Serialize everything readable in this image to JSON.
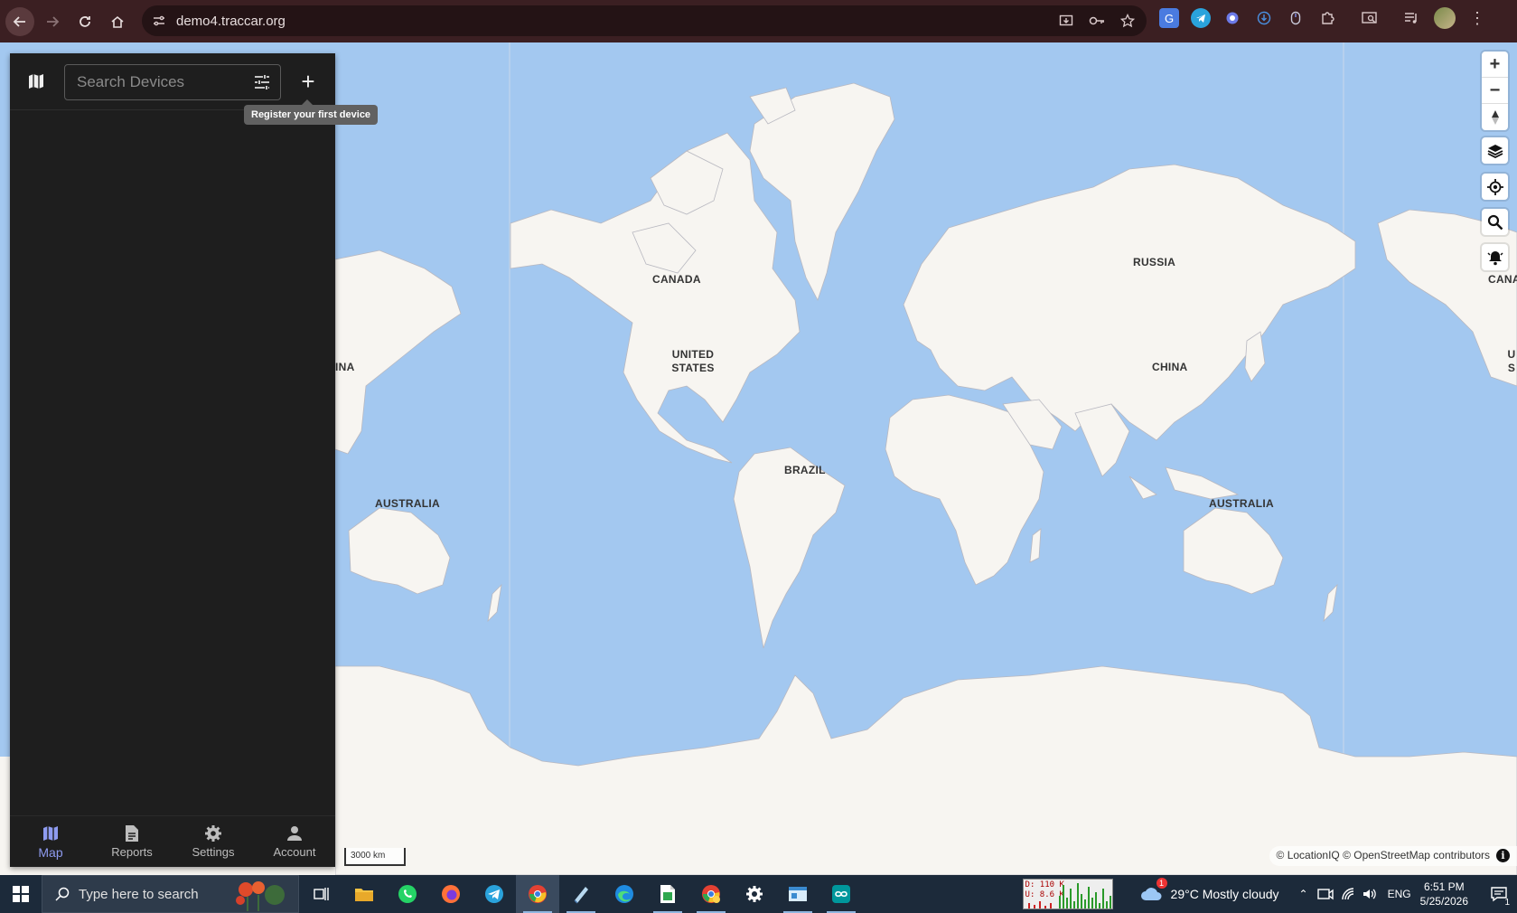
{
  "browser": {
    "url": "demo4.traccar.org"
  },
  "sidebar": {
    "search_placeholder": "Search Devices",
    "add_tooltip": "Register your first device",
    "nav": [
      {
        "label": "Map",
        "icon": "map-icon",
        "active": true
      },
      {
        "label": "Reports",
        "icon": "document-icon",
        "active": false
      },
      {
        "label": "Settings",
        "icon": "gear-icon",
        "active": false
      },
      {
        "label": "Account",
        "icon": "person-icon",
        "active": false
      }
    ]
  },
  "map": {
    "labels": {
      "canada": "CANADA",
      "united_states": "UNITED STATES",
      "brazil": "BRAZIL",
      "russia": "RUSSIA",
      "china": "CHINA",
      "australia_left": "AUSTRALIA",
      "australia_right": "AUSTRALIA",
      "china_partial": "INA",
      "canada_partial": "CANA",
      "us_partial": "U S"
    },
    "scale": "3000 km",
    "attribution": "© LocationIQ © OpenStreetMap contributors",
    "colors": {
      "water": "#a3c8f0",
      "land": "#f7f5f1"
    }
  },
  "taskbar": {
    "search_placeholder": "Type here to search",
    "weather": "29°C  Mostly cloudy",
    "weather_badge": "1",
    "language": "ENG",
    "time": "6:51 PM",
    "date": "5/25/2026",
    "net_down": "D: 110 K",
    "net_up": "U: 8.6 K",
    "notifications": "1"
  }
}
